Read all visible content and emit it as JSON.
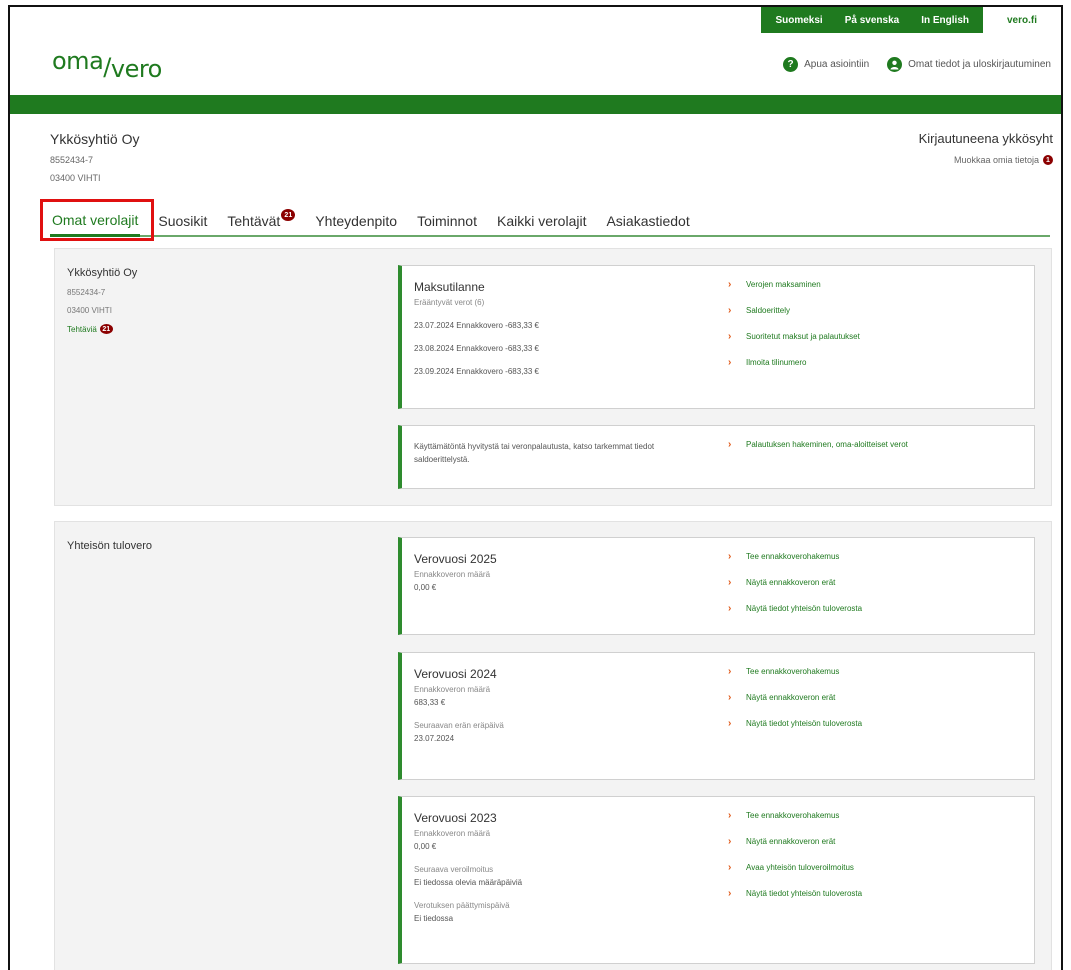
{
  "language_bar": {
    "languages": [
      "Suomeksi",
      "På svenska",
      "In English"
    ],
    "site": "vero.fi"
  },
  "header": {
    "logo": {
      "part1": "oma",
      "part2": "vero"
    },
    "help": "Apua asiointiin",
    "profile": "Omat tiedot ja uloskirjautuminen"
  },
  "company": {
    "name": "Ykkösyhtiö Oy",
    "business_id": "8552434-7",
    "address": "03400 VIHTI"
  },
  "login": {
    "status": "Kirjautuneena ykkösyht",
    "edit": "Muokkaa omia tietoja",
    "edit_badge": "1"
  },
  "tabs": [
    {
      "label": "Omat verolajit"
    },
    {
      "label": "Suosikit"
    },
    {
      "label": "Tehtävät",
      "badge": "21"
    },
    {
      "label": "Yhteydenpito"
    },
    {
      "label": "Toiminnot"
    },
    {
      "label": "Kaikki verolajit"
    },
    {
      "label": "Asiakastiedot"
    }
  ],
  "summary": {
    "left": {
      "name": "Ykkösyhtiö Oy",
      "business_id": "8552434-7",
      "address": "03400 VIHTI",
      "tasks_label": "Tehtäviä",
      "tasks_badge": "21"
    },
    "payment": {
      "title": "Maksutilanne",
      "subtitle": "Erääntyvät verot (6)",
      "rows": [
        "23.07.2024 Ennakkovero -683,33 €",
        "23.08.2024 Ennakkovero -683,33 €",
        "23.09.2024 Ennakkovero -683,33 €"
      ],
      "links": [
        "Verojen maksaminen",
        "Saldoerittely",
        "Suoritetut maksut ja palautukset",
        "Ilmoita tilinumero"
      ]
    },
    "refund": {
      "text": "Käyttämätöntä hyvitystä tai veronpalautusta, katso tarkemmat tiedot saldoerittelystä.",
      "link": "Palautuksen hakeminen, oma-aloitteiset verot"
    }
  },
  "corporate_tax": {
    "title": "Yhteisön tulovero",
    "years": [
      {
        "title": "Verovuosi 2025",
        "fields": [
          {
            "label": "Ennakkoveron määrä",
            "value": "0,00 €"
          }
        ],
        "links": [
          "Tee ennakkoverohakemus",
          "Näytä ennakkoveron erät",
          "Näytä tiedot yhteisön tuloverosta"
        ]
      },
      {
        "title": "Verovuosi 2024",
        "fields": [
          {
            "label": "Ennakkoveron määrä",
            "value": "683,33 €"
          },
          {
            "label": "Seuraavan erän eräpäivä",
            "value": "23.07.2024"
          }
        ],
        "links": [
          "Tee ennakkoverohakemus",
          "Näytä ennakkoveron erät",
          "Näytä tiedot yhteisön tuloverosta"
        ]
      },
      {
        "title": "Verovuosi 2023",
        "fields": [
          {
            "label": "Ennakkoveron määrä",
            "value": "0,00 €"
          },
          {
            "label": "Seuraava veroilmoitus",
            "value": "Ei tiedossa olevia määräpäiviä"
          },
          {
            "label": "Verotuksen päättymispäivä",
            "value": "Ei tiedossa"
          }
        ],
        "links": [
          "Tee ennakkoverohakemus",
          "Näytä ennakkoveron erät",
          "Avaa yhteisön tuloveroilmoitus",
          "Näytä tiedot yhteisön tuloverosta"
        ]
      }
    ]
  },
  "colors": {
    "brand_green": "#1f7a1f",
    "card_accent": "#2e8b2e",
    "badge_red": "#8b0000",
    "chevron": "#e05a1a",
    "highlight": "#e01010"
  }
}
